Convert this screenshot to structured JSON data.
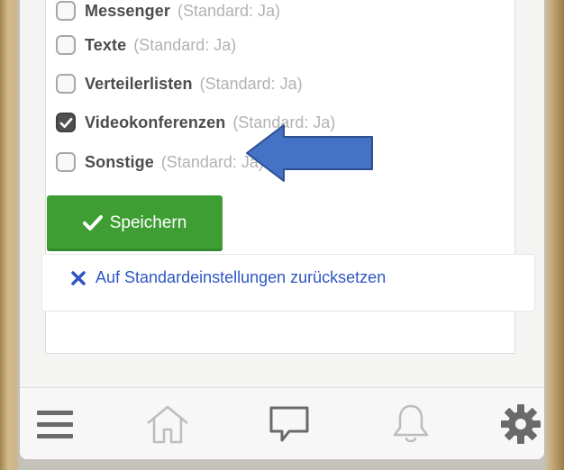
{
  "settings": {
    "options": [
      {
        "label": "Messenger",
        "default": "(Standard: Ja)",
        "checked": false
      },
      {
        "label": "Texte",
        "default": "(Standard: Ja)",
        "checked": false
      },
      {
        "label": "Verteilerlisten",
        "default": "(Standard: Ja)",
        "checked": false
      },
      {
        "label": "Videokonferenzen",
        "default": "(Standard: Ja)",
        "checked": true
      },
      {
        "label": "Sonstige",
        "default": "(Standard: Ja)",
        "checked": false
      }
    ]
  },
  "actions": {
    "save_label": "Speichern",
    "reset_label": "Auf Standardeinstellungen zurücksetzen"
  },
  "tab_bar": {
    "items": [
      "menu-icon",
      "home-icon",
      "chat-icon",
      "bell-icon",
      "gear-icon"
    ]
  },
  "colors": {
    "save_button": "#3e9e34",
    "reset_link": "#2f56c2",
    "annotation_arrow": "#4472c4"
  }
}
